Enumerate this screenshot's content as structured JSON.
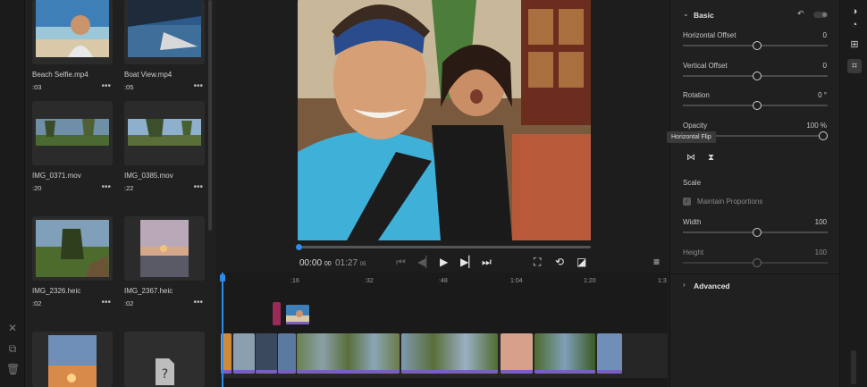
{
  "media": {
    "items": [
      {
        "name": "Beach Selfie.mp4",
        "duration": ":03"
      },
      {
        "name": "Boat View.mp4",
        "duration": ":05"
      },
      {
        "name": "IMG_0371.mov",
        "duration": ":20"
      },
      {
        "name": "IMG_0385.mov",
        "duration": ":22"
      },
      {
        "name": "IMG_2326.heic",
        "duration": ":02"
      },
      {
        "name": "IMG_2367.heic",
        "duration": ":02"
      }
    ],
    "more_label": "•••"
  },
  "player": {
    "current_time": "00:00",
    "current_frames": "00",
    "total_time": "01:27",
    "total_frames": "05",
    "progress": 0.0
  },
  "timeline": {
    "ticks": [
      ":16",
      ":32",
      ":48",
      "1:04",
      "1:20",
      "1:3"
    ]
  },
  "properties": {
    "basic_label": "Basic",
    "horizontal_offset": {
      "label": "Horizontal Offset",
      "value": "0"
    },
    "vertical_offset": {
      "label": "Vertical Offset",
      "value": "0"
    },
    "rotation": {
      "label": "Rotation",
      "value": "0 °"
    },
    "opacity": {
      "label": "Opacity",
      "value": "100 %"
    },
    "tooltip": "Horizontal Flip",
    "scale_label": "Scale",
    "maintain_label": "Maintain Proportions",
    "width": {
      "label": "Width",
      "value": "100"
    },
    "height": {
      "label": "Height",
      "value": "100"
    },
    "advanced_label": "Advanced"
  },
  "colors": {
    "accent": "#2d8ceb",
    "clip_band": "#7b5fc0",
    "marker": "#9a2b57"
  }
}
